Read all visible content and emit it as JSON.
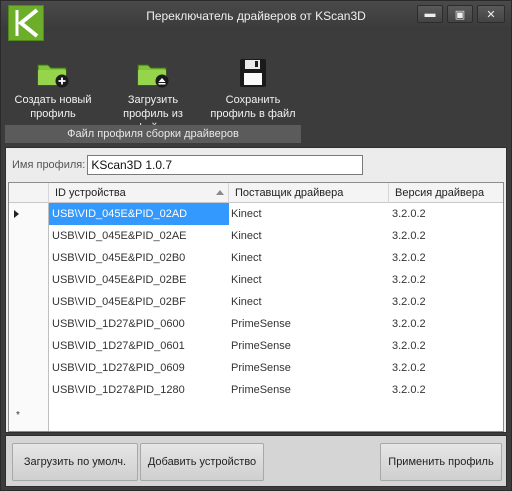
{
  "window": {
    "title": "Переключатель драйверов от KScan3D",
    "controls": {
      "minimize": "▬",
      "maximize": "▣",
      "close": "✕"
    }
  },
  "toolbar": {
    "create_label_1": "Создать новый",
    "create_label_2": "профиль",
    "load_label_1": "Загрузить",
    "load_label_2": "профиль из файла",
    "save_label_1": "Сохранить",
    "save_label_2": "профиль в файл",
    "group_caption": "Файл профиля сборки драйверов"
  },
  "profile": {
    "label": "Имя профиля:",
    "value": "KScan3D 1.0.7"
  },
  "grid": {
    "columns": [
      "ID устройства",
      "Поставщик драйвера",
      "Версия драйвера"
    ],
    "rows": [
      {
        "id": "USB\\VID_045E&PID_02AD",
        "vendor": "Kinect",
        "version": "3.2.0.2"
      },
      {
        "id": "USB\\VID_045E&PID_02AE",
        "vendor": "Kinect",
        "version": "3.2.0.2"
      },
      {
        "id": "USB\\VID_045E&PID_02B0",
        "vendor": "Kinect",
        "version": "3.2.0.2"
      },
      {
        "id": "USB\\VID_045E&PID_02BE",
        "vendor": "Kinect",
        "version": "3.2.0.2"
      },
      {
        "id": "USB\\VID_045E&PID_02BF",
        "vendor": "Kinect",
        "version": "3.2.0.2"
      },
      {
        "id": "USB\\VID_1D27&PID_0600",
        "vendor": "PrimeSense",
        "version": "3.2.0.2"
      },
      {
        "id": "USB\\VID_1D27&PID_0601",
        "vendor": "PrimeSense",
        "version": "3.2.0.2"
      },
      {
        "id": "USB\\VID_1D27&PID_0609",
        "vendor": "PrimeSense",
        "version": "3.2.0.2"
      },
      {
        "id": "USB\\VID_1D27&PID_1280",
        "vendor": "PrimeSense",
        "version": "3.2.0.2"
      }
    ],
    "new_row_marker": "*"
  },
  "buttons": {
    "load_default": "Загрузить по умолч.",
    "add_device": "Добавить устройство",
    "apply_profile": "Применить профиль"
  },
  "colors": {
    "accent": "#6cae2a",
    "selection": "#3399ff"
  }
}
